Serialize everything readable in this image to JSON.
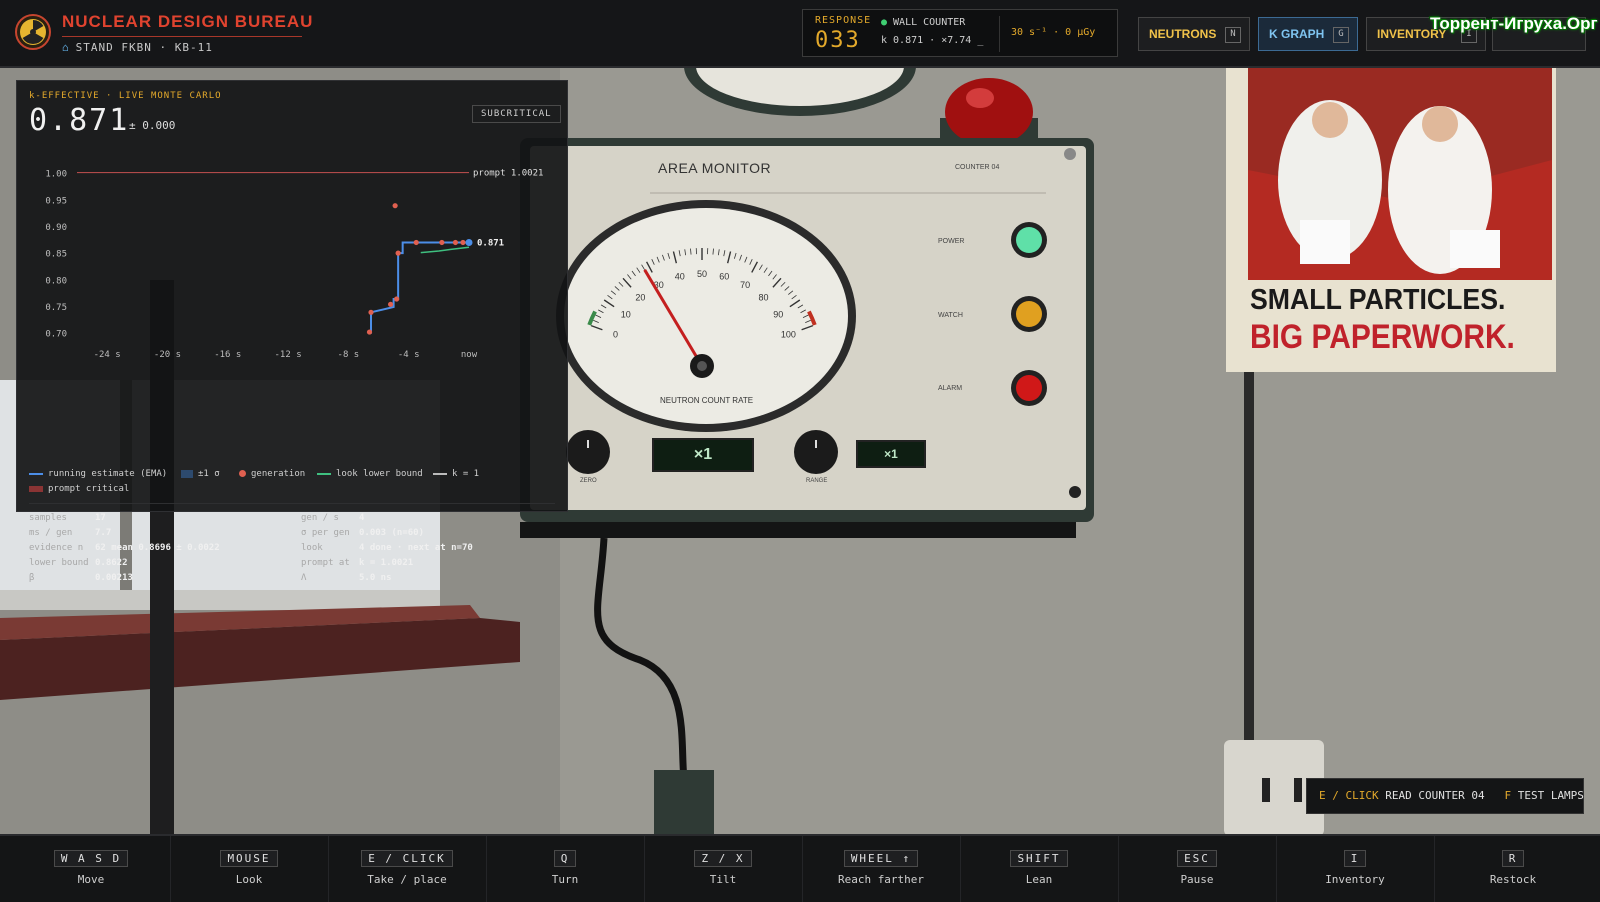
{
  "brand": {
    "title": "NUCLEAR DESIGN BUREAU",
    "subtitle": "STAND FKBN · KB-11",
    "logo_icon": "radiation-icon"
  },
  "response": {
    "label": "RESPONSE",
    "value": "033",
    "counter_label": "WALL COUNTER",
    "counter_readout": "k 0.871 · ×7.74 _",
    "rate": "30 s⁻¹ · 0 µGy"
  },
  "toolbar": {
    "neutrons": {
      "label": "NEUTRONS",
      "key": "N"
    },
    "kgraph": {
      "label": "K GRAPH",
      "key": "G"
    },
    "inventory": {
      "label": "INVENTORY",
      "key": "I"
    }
  },
  "watermark": "Торрент-Игруха.Орг",
  "kpanel": {
    "header": "k-EFFECTIVE · LIVE MONTE CARLO",
    "k_value": "0.871",
    "k_error": "± 0.000",
    "status": "SUBCRITICAL",
    "legend": {
      "ema": "running estimate (EMA)",
      "sigma": "±1 σ",
      "generation": "generation",
      "look": "look lower bound",
      "k1": "k = 1",
      "prompt": "prompt critical"
    },
    "stats_left": [
      {
        "key": "samples",
        "value": "17"
      },
      {
        "key": "ms / gen",
        "value": "7.7"
      },
      {
        "key": "evidence n",
        "value": "62 mean 0.8696 ± 0.0022"
      },
      {
        "key": "lower bound",
        "value": "0.8622"
      },
      {
        "key": "β",
        "value": "0.00213"
      }
    ],
    "stats_right": [
      {
        "key": "gen / s",
        "value": "4"
      },
      {
        "key": "σ per gen",
        "value": "0.003 (n=60)"
      },
      {
        "key": "look",
        "value": "4 done · next at n=70"
      },
      {
        "key": "prompt at",
        "value": "k = 1.0021"
      },
      {
        "key": "Λ",
        "value": "5.0 ns"
      }
    ]
  },
  "chart_data": {
    "type": "line",
    "title": "k-EFFECTIVE · LIVE MONTE CARLO",
    "xlabel": "",
    "ylabel": "",
    "x_ticks": [
      "-24 s",
      "-20 s",
      "-16 s",
      "-12 s",
      "-8 s",
      "-4 s",
      "now"
    ],
    "y_ticks": [
      "1.00",
      "0.95",
      "0.90",
      "0.85",
      "0.80",
      "0.75",
      "0.70"
    ],
    "xlim": [
      -26,
      0
    ],
    "ylim": [
      0.69,
      1.005
    ],
    "reference_lines": [
      {
        "name": "prompt 1.0021",
        "y": 1.0021
      }
    ],
    "series": [
      {
        "name": "running estimate (EMA)",
        "points": [
          [
            -6.5,
            0.7
          ],
          [
            -6.5,
            0.74
          ],
          [
            -5.0,
            0.75
          ],
          [
            -5.0,
            0.765
          ],
          [
            -4.7,
            0.765
          ],
          [
            -4.7,
            0.851
          ],
          [
            -4.4,
            0.851
          ],
          [
            -4.4,
            0.871
          ],
          [
            0,
            0.871
          ]
        ]
      },
      {
        "name": "generation",
        "points": [
          [
            -6.6,
            0.703
          ],
          [
            -6.5,
            0.74
          ],
          [
            -5.2,
            0.755
          ],
          [
            -4.8,
            0.765
          ],
          [
            -4.9,
            0.94
          ],
          [
            -4.7,
            0.851
          ],
          [
            -3.5,
            0.871
          ],
          [
            -1.8,
            0.871
          ],
          [
            -0.9,
            0.871
          ],
          [
            -0.4,
            0.871
          ],
          [
            0,
            0.871
          ]
        ]
      },
      {
        "name": "look lower bound",
        "points": [
          [
            -3.2,
            0.852
          ],
          [
            -2.0,
            0.855
          ],
          [
            -1.2,
            0.858
          ],
          [
            0,
            0.862
          ]
        ]
      }
    ],
    "end_label": "0.871"
  },
  "monitor": {
    "title": "AREA MONITOR",
    "counter": "COUNTER 04",
    "gauge_label": "NEUTRON COUNT RATE",
    "scale": [
      "0",
      "10",
      "20",
      "30",
      "40",
      "50",
      "60",
      "70",
      "80",
      "90",
      "100"
    ],
    "lamps": [
      {
        "label": "POWER",
        "color": "#5fe0a8"
      },
      {
        "label": "WATCH",
        "color": "#e0a020"
      },
      {
        "label": "ALARM",
        "color": "#d01818"
      }
    ],
    "display_main": "×1",
    "display_range": "×1",
    "knob_zero": "ZERO",
    "knob_range": "RANGE",
    "needle_value": 28
  },
  "poster": {
    "line1": "SMALL PARTICLES.",
    "line2": "BIG PAPERWORK."
  },
  "hint": {
    "key1": "E / CLICK",
    "text1": "READ COUNTER 04",
    "key2": "F",
    "text2": "TEST LAMPS"
  },
  "controls": [
    {
      "key": "W A S D",
      "action": "Move"
    },
    {
      "key": "MOUSE",
      "action": "Look"
    },
    {
      "key": "E / CLICK",
      "action": "Take / place"
    },
    {
      "key": "Q",
      "action": "Turn"
    },
    {
      "key": "Z / X",
      "action": "Tilt"
    },
    {
      "key": "WHEEL ↑",
      "action": "Reach farther"
    },
    {
      "key": "SHIFT",
      "action": "Lean"
    },
    {
      "key": "ESC",
      "action": "Pause"
    },
    {
      "key": "I",
      "action": "Inventory"
    },
    {
      "key": "R",
      "action": "Restock"
    }
  ]
}
